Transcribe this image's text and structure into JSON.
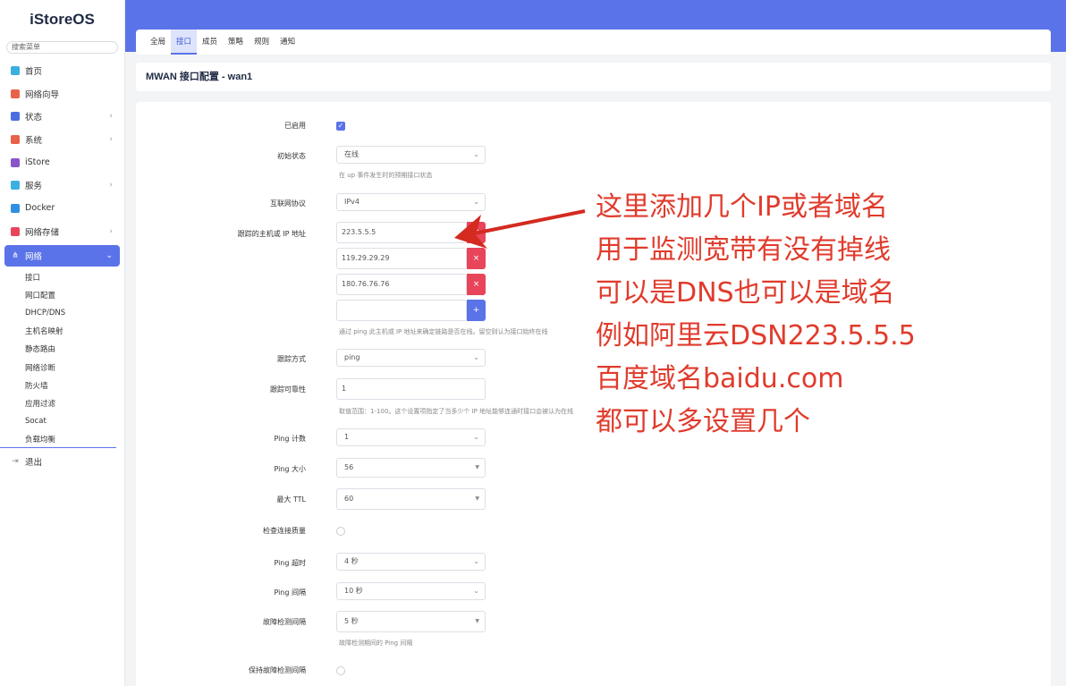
{
  "app": {
    "logo": "iStoreOS"
  },
  "sidebar": {
    "search_placeholder": "搜索菜单",
    "items": [
      {
        "label": "首页",
        "icon": "home-icon",
        "color": "#3bb0e0"
      },
      {
        "label": "网络向导",
        "icon": "wizard-icon",
        "color": "#e8624a"
      },
      {
        "label": "状态",
        "icon": "status-icon",
        "color": "#4a6ee0",
        "chevron": "›"
      },
      {
        "label": "系统",
        "icon": "gear-icon",
        "color": "#e8624a",
        "chevron": "›"
      },
      {
        "label": "iStore",
        "icon": "store-icon",
        "color": "#8a55c8"
      },
      {
        "label": "服务",
        "icon": "services-icon",
        "color": "#3bb0e0",
        "chevron": "›"
      },
      {
        "label": "Docker",
        "icon": "docker-icon",
        "color": "#2f8fe0"
      },
      {
        "label": "网络存储",
        "icon": "storage-icon",
        "color": "#e8455b",
        "chevron": "›"
      },
      {
        "label": "网络",
        "icon": "network-icon",
        "color": "#ffffff",
        "chevron": "⌄"
      }
    ],
    "sub_items": [
      "接口",
      "网口配置",
      "DHCP/DNS",
      "主机名映射",
      "静态路由",
      "网络诊断",
      "防火墙",
      "应用过滤",
      "Socat",
      "负载均衡"
    ],
    "logout": "退出"
  },
  "tabs": [
    "全局",
    "接口",
    "成员",
    "策略",
    "规则",
    "通知"
  ],
  "page_title": "MWAN 接口配置 - wan1",
  "form": {
    "enabled_label": "已启用",
    "initial_state_label": "初始状态",
    "initial_state_value": "在线",
    "initial_state_hint": "在 up 事件发生时的预期接口状态",
    "protocol_label": "互联网协议",
    "protocol_value": "IPv4",
    "track_ip_label": "跟踪的主机或 IP 地址",
    "track_ips": [
      "223.5.5.5",
      "119.29.29.29",
      "180.76.76.76",
      ""
    ],
    "remove_symbol": "×",
    "add_symbol": "+",
    "track_ip_hint": "通过 ping 此主机或 IP 地址来确定链路是否在线。留空则认为接口始终在线",
    "track_method_label": "跟踪方式",
    "track_method_value": "ping",
    "reliability_label": "跟踪可靠性",
    "reliability_value": "1",
    "reliability_hint": "取值范围：1-100。这个设置项指定了当多少个 IP 地址能够连通时接口会被认为在线",
    "ping_count_label": "Ping 计数",
    "ping_count_value": "1",
    "ping_size_label": "Ping 大小",
    "ping_size_value": "56",
    "max_ttl_label": "最大 TTL",
    "max_ttl_value": "60",
    "check_quality_label": "检查连接质量",
    "ping_timeout_label": "Ping 超时",
    "ping_timeout_value": "4 秒",
    "ping_interval_label": "Ping 间隔",
    "ping_interval_value": "10 秒",
    "failure_interval_label": "故障检测间隔",
    "failure_interval_value": "5 秒",
    "failure_interval_hint": "故障检测期间的 Ping 间隔",
    "keep_failure_label": "保持故障检测间隔"
  },
  "annotation": {
    "lines": [
      "这里添加几个IP或者域名",
      "用于监测宽带有没有掉线",
      "可以是DNS也可以是域名",
      "例如阿里云DSN223.5.5.5",
      "百度域名baidu.com",
      "都可以多设置几个"
    ],
    "color": "#e03b2c"
  }
}
